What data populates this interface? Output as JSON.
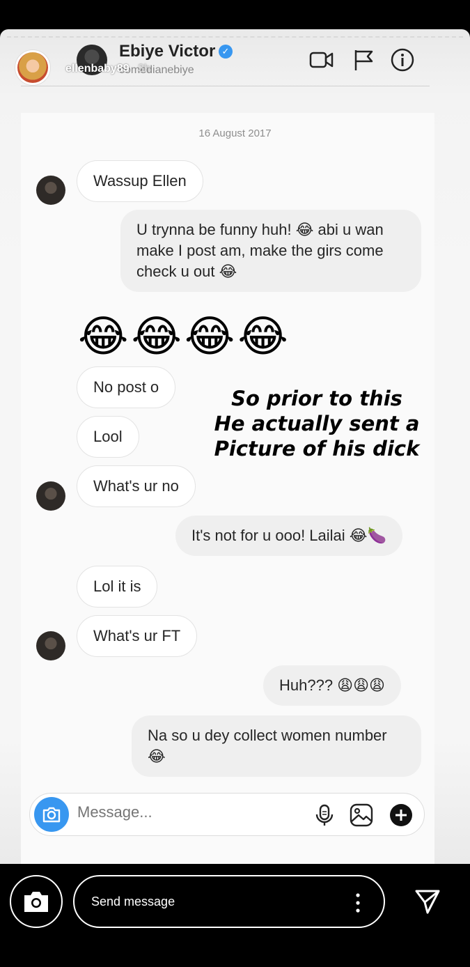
{
  "story": {
    "username": "ellenbaby89",
    "time": "3h",
    "send_message_label": "Send message"
  },
  "chat": {
    "contact_name": "Ebiye Victor",
    "contact_handle": "comedianebiye",
    "date": "16 August 2017",
    "messages": [
      {
        "dir": "in",
        "text": "Wassup Ellen"
      },
      {
        "dir": "out",
        "text": "U trynna be funny huh! 😂 abi u wan make I post am, make the girs come check u out 😂"
      },
      {
        "dir": "emoji",
        "text": "😂😂😂😂"
      },
      {
        "dir": "in",
        "text": "No post o"
      },
      {
        "dir": "in",
        "text": "Lool"
      },
      {
        "dir": "in",
        "text": "What's ur no"
      },
      {
        "dir": "out",
        "text": "It's not for u ooo! Lailai 😂🍆"
      },
      {
        "dir": "in",
        "text": "Lol it is"
      },
      {
        "dir": "in",
        "text": "What's ur FT"
      },
      {
        "dir": "out",
        "text": "Huh??? 😩😩😩"
      },
      {
        "dir": "out",
        "text": "Na so u dey collect women number 😂"
      }
    ],
    "composer_placeholder": "Message..."
  },
  "caption": {
    "line1": "So prior to this",
    "line2": "He actually sent a",
    "line3": "Picture of his dick"
  },
  "icons": {
    "video": "video-camera-icon",
    "report": "flag-icon",
    "info": "info-icon",
    "mic": "microphone-icon",
    "gallery": "gallery-icon",
    "add": "plus-circle-icon",
    "camera": "camera-icon",
    "more": "more-vertical-icon",
    "send": "send-icon"
  },
  "colors": {
    "accent": "#3897f0",
    "incoming_bubble": "#ffffff",
    "outgoing_bubble": "#efefef"
  }
}
